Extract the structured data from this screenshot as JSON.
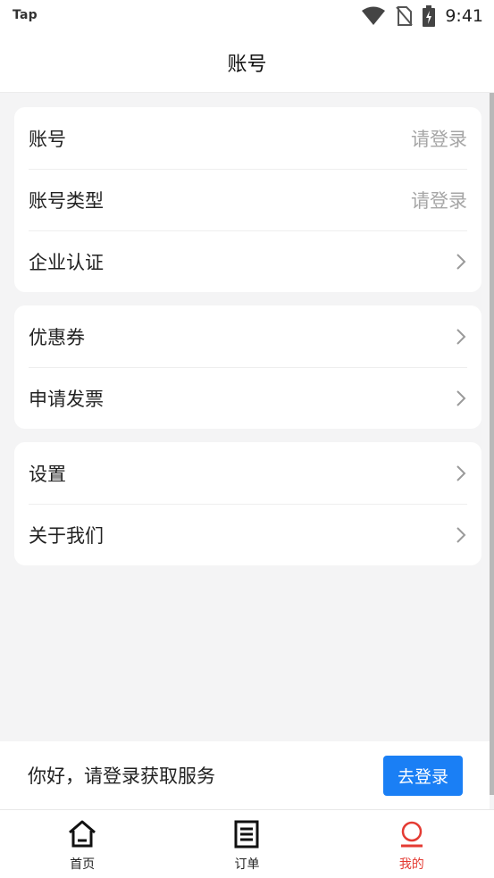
{
  "status": {
    "app_tag": "Tap",
    "time": "9:41"
  },
  "header": {
    "title": "账号"
  },
  "sections": [
    {
      "rows": [
        {
          "label": "账号",
          "value": "请登录"
        },
        {
          "label": "账号类型",
          "value": "请登录"
        },
        {
          "label": "企业认证"
        }
      ]
    },
    {
      "rows": [
        {
          "label": "优惠券"
        },
        {
          "label": "申请发票"
        }
      ]
    },
    {
      "rows": [
        {
          "label": "设置"
        },
        {
          "label": "关于我们"
        }
      ]
    }
  ],
  "login_bar": {
    "message": "你好，请登录获取服务",
    "button_label": "去登录"
  },
  "bottom_nav": {
    "items": [
      {
        "label": "首页",
        "icon": "home-icon"
      },
      {
        "label": "订单",
        "icon": "order-list-icon"
      },
      {
        "label": "我的",
        "icon": "profile-icon",
        "active": true
      }
    ]
  },
  "colors": {
    "accent": "#1a7ff5",
    "active_tab": "#e43b33",
    "background": "#f4f4f5",
    "muted_text": "#a6a6a6"
  }
}
